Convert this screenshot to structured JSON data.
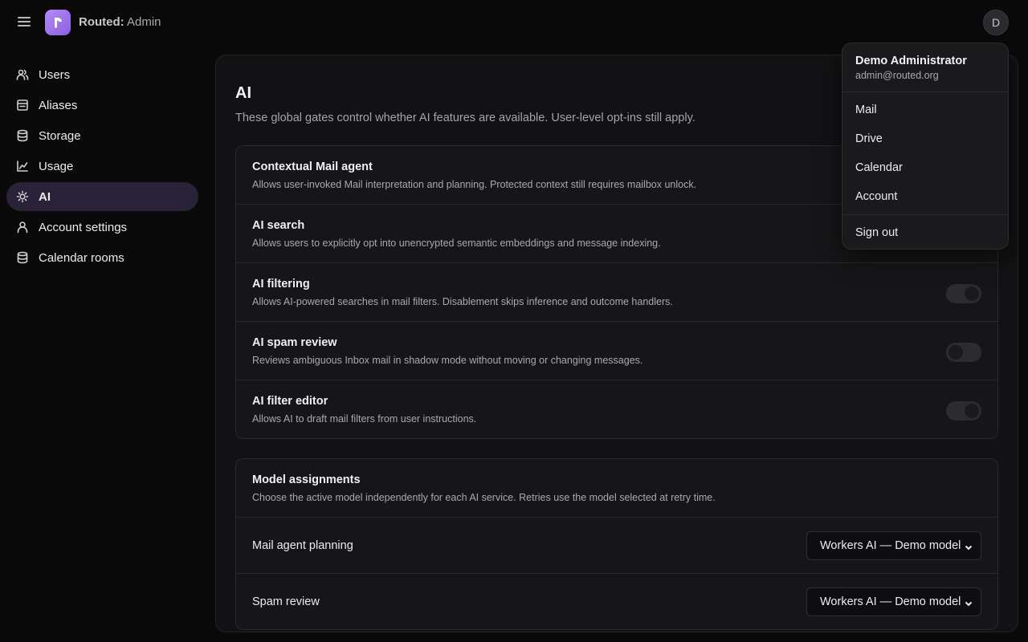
{
  "header": {
    "brand_bold": "Routed:",
    "brand_rest": " Admin",
    "avatar_initial": "D"
  },
  "sidebar": {
    "items": [
      {
        "label": "Users",
        "icon": "users-icon"
      },
      {
        "label": "Aliases",
        "icon": "aliases-icon"
      },
      {
        "label": "Storage",
        "icon": "database-icon"
      },
      {
        "label": "Usage",
        "icon": "chart-line-icon"
      },
      {
        "label": "AI",
        "icon": "sun-icon",
        "active": true
      },
      {
        "label": "Account settings",
        "icon": "user-icon"
      },
      {
        "label": "Calendar rooms",
        "icon": "database-icon"
      }
    ]
  },
  "main": {
    "title": "AI",
    "description": "These global gates control whether AI features are available. User-level opt-ins still apply.",
    "features": [
      {
        "title": "Contextual Mail agent",
        "description": "Allows user-invoked Mail interpretation and planning. Protected context still requires mailbox unlock.",
        "enabled": true
      },
      {
        "title": "AI search",
        "description": "Allows users to explicitly opt into unencrypted semantic embeddings and message indexing.",
        "enabled": true
      },
      {
        "title": "AI filtering",
        "description": "Allows AI-powered searches in mail filters. Disablement skips inference and outcome handlers.",
        "enabled": true
      },
      {
        "title": "AI spam review",
        "description": "Reviews ambiguous Inbox mail in shadow mode without moving or changing messages.",
        "enabled": false
      },
      {
        "title": "AI filter editor",
        "description": "Allows AI to draft mail filters from user instructions.",
        "enabled": true
      }
    ],
    "models": {
      "title": "Model assignments",
      "description": "Choose the active model independently for each AI service. Retries use the model selected at retry time.",
      "rows": [
        {
          "label": "Mail agent planning",
          "selected": "Workers AI — Demo model"
        },
        {
          "label": "Spam review",
          "selected": "Workers AI — Demo model"
        }
      ]
    }
  },
  "user_menu": {
    "name": "Demo Administrator",
    "email": "admin@routed.org",
    "items": [
      "Mail",
      "Drive",
      "Calendar",
      "Account"
    ],
    "sign_out": "Sign out"
  },
  "colors": {
    "accent": "#9b6ef0",
    "active_nav_bg": "#2a2238",
    "background": "#0a0a0b",
    "panel": "#121214"
  }
}
